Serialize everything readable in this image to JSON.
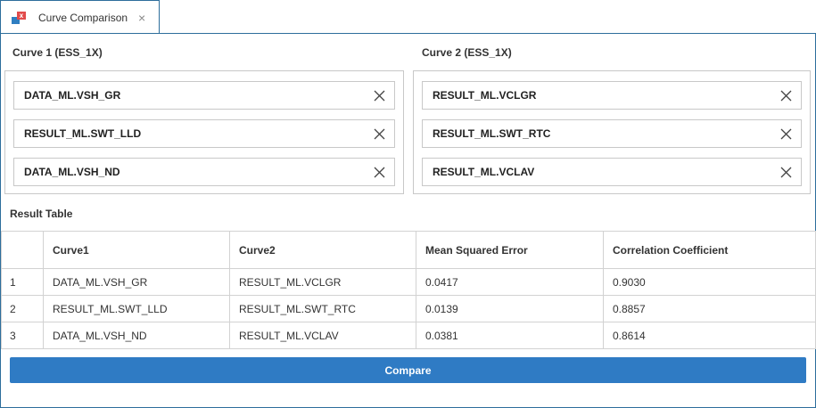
{
  "tab": {
    "title": "Curve Comparison",
    "close_symbol": "×",
    "icon": "curve-compare-icon",
    "icon_badge": "x"
  },
  "curve1": {
    "label": "Curve 1 (ESS_1X)",
    "items": [
      "DATA_ML.VSH_GR",
      "RESULT_ML.SWT_LLD",
      "DATA_ML.VSH_ND"
    ]
  },
  "curve2": {
    "label": "Curve 2 (ESS_1X)",
    "items": [
      "RESULT_ML.VCLGR",
      "RESULT_ML.SWT_RTC",
      "RESULT_ML.VCLAV"
    ]
  },
  "result_table": {
    "title": "Result Table",
    "columns": [
      "",
      "Curve1",
      "Curve2",
      "Mean Squared Error",
      "Correlation Coefficient"
    ],
    "rows": [
      [
        "1",
        "DATA_ML.VSH_GR",
        "RESULT_ML.VCLGR",
        "0.0417",
        "0.9030"
      ],
      [
        "2",
        "RESULT_ML.SWT_LLD",
        "RESULT_ML.SWT_RTC",
        "0.0139",
        "0.8857"
      ],
      [
        "3",
        "DATA_ML.VSH_ND",
        "RESULT_ML.VCLAV",
        "0.0381",
        "0.8614"
      ]
    ]
  },
  "compare_button": {
    "label": "Compare"
  },
  "colors": {
    "accent": "#2f7bc4",
    "border": "#2d6e9c",
    "icon_red": "#e24b4b",
    "icon_blue": "#2f7ec1"
  }
}
